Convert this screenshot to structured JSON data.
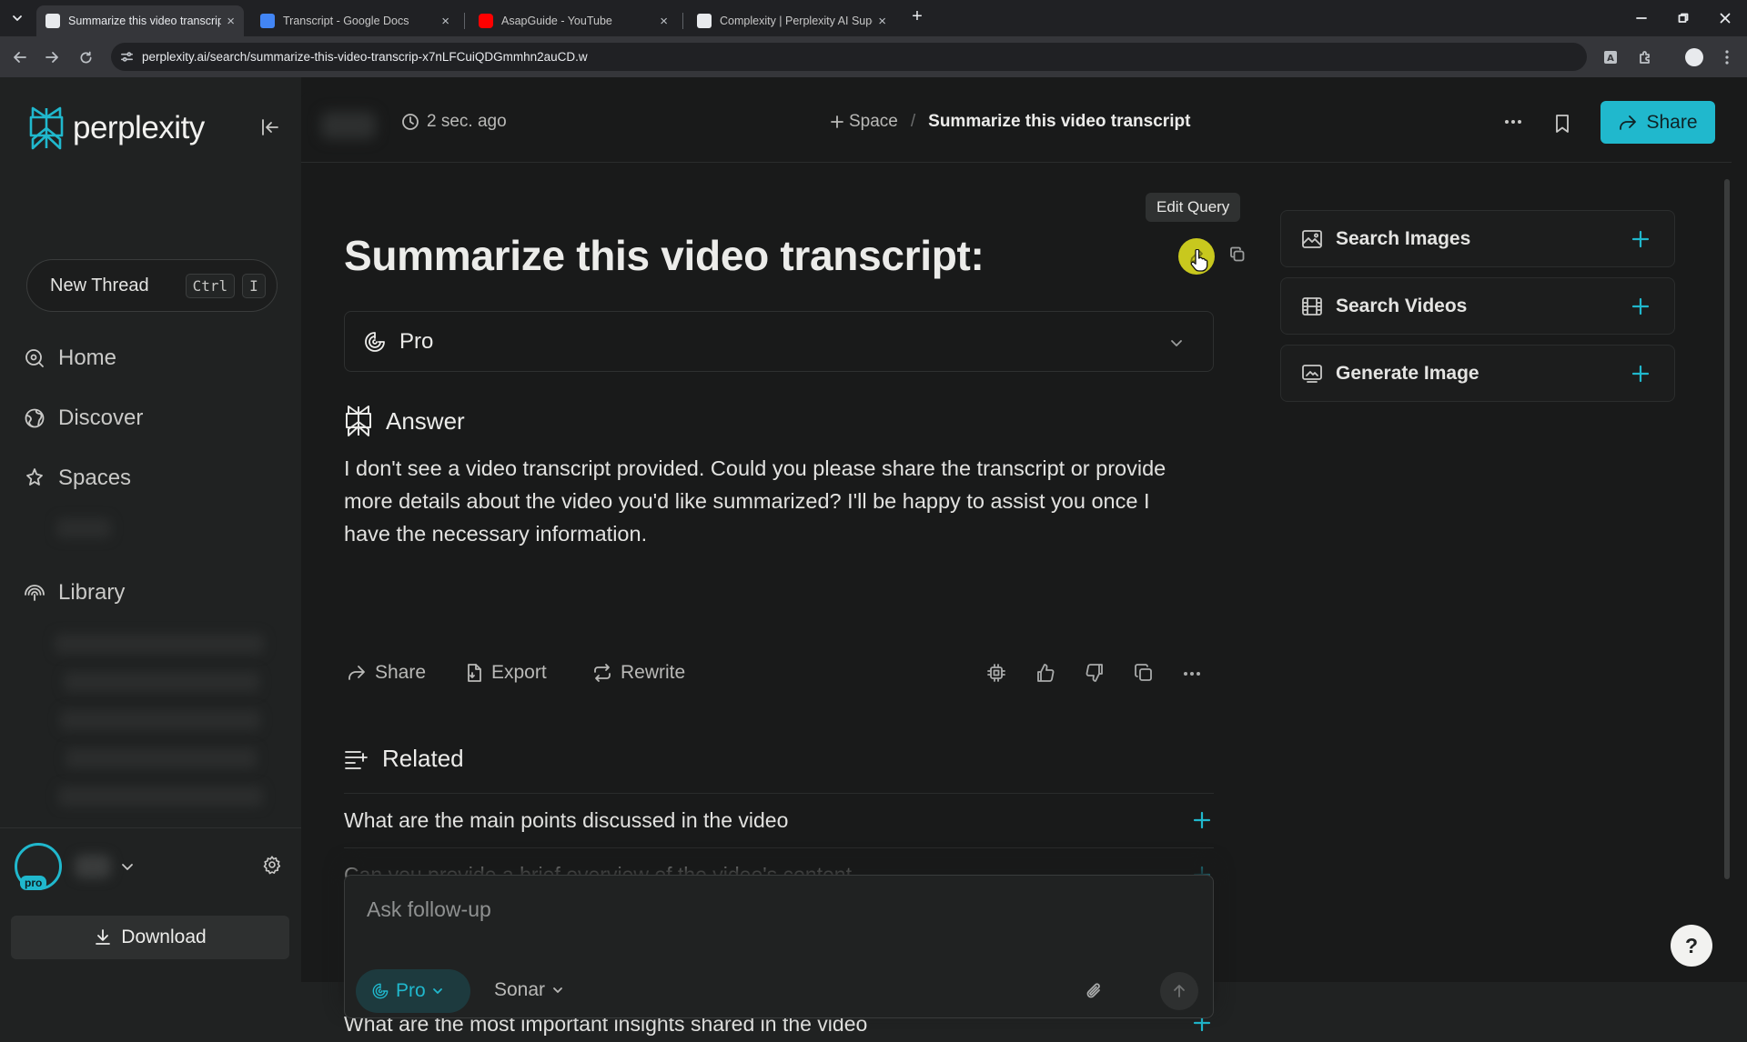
{
  "browser": {
    "tabs": [
      {
        "title": "Summarize this video transcript",
        "active": true
      },
      {
        "title": "Transcript - Google Docs",
        "active": false
      },
      {
        "title": "AsapGuide - YouTube",
        "active": false
      },
      {
        "title": "Complexity | Perplexity AI Supe",
        "active": false
      }
    ],
    "new_tab_glyph": "+",
    "close_glyph": "×",
    "url": "perplexity.ai/search/summarize-this-video-transcrip-x7nLFCuiQDGmmhn2auCD.w",
    "colors": {
      "chrome_dark": "#202124",
      "chrome_toolbar": "#35363a",
      "youtube_red": "#ff0000",
      "docs_blue": "#4285f4"
    }
  },
  "sidebar": {
    "logo_text": "perplexity",
    "new_thread": {
      "label": "New Thread",
      "keys": [
        "Ctrl",
        "I"
      ]
    },
    "nav": [
      {
        "label": "Home",
        "icon": "search-icon"
      },
      {
        "label": "Discover",
        "icon": "globe-icon"
      },
      {
        "label": "Spaces",
        "icon": "spaces-icon"
      },
      {
        "label": "Library",
        "icon": "library-icon"
      }
    ],
    "pro_badge": "pro",
    "download_label": "Download"
  },
  "header": {
    "time_ago": "2 sec. ago",
    "space_label": "Space",
    "breadcrumb_separator": "/",
    "thread_title": "Summarize this video transcript",
    "share_label": "Share"
  },
  "thread": {
    "query": "Summarize this video transcript:",
    "tooltip": "Edit Query",
    "model_panel_label": "Pro",
    "answer_heading": "Answer",
    "answer_text": "I don't see a video transcript provided. Could you please share the transcript or provide more details about the video you'd like summarized? I'll be happy to assist you once I have the necessary information.",
    "actions": {
      "share": "Share",
      "export": "Export",
      "rewrite": "Rewrite"
    },
    "related_heading": "Related",
    "related": [
      "What are the main points discussed in the video",
      "Can you provide a brief overview of the video's content",
      "What are the most important insights shared in the video"
    ],
    "followup": {
      "placeholder": "Ask follow-up",
      "mode_label": "Pro",
      "model_label": "Sonar"
    }
  },
  "widgets": [
    {
      "label": "Search Images",
      "icon": "image-icon"
    },
    {
      "label": "Search Videos",
      "icon": "film-icon"
    },
    {
      "label": "Generate Image",
      "icon": "generate-image-icon"
    }
  ],
  "help_label": "?",
  "colors": {
    "accent": "#20b8cd",
    "bg_main": "#191a1a",
    "bg_sidebar": "#202222",
    "cursor_highlight": "#c8c81e"
  }
}
